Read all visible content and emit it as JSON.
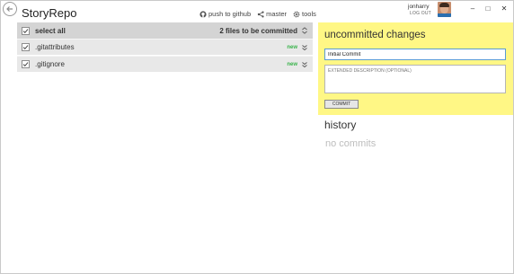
{
  "app": {
    "title": "StoryRepo",
    "back_icon": "back-arrow-icon"
  },
  "toolbar": {
    "push_label": "push to github",
    "branch_label": "master",
    "tools_label": "tools",
    "icons": [
      "github-icon",
      "branch-icon",
      "gear-icon"
    ]
  },
  "user": {
    "name": "jonharry",
    "logout_label": "LOG OUT"
  },
  "window_controls": {
    "minimize": "–",
    "maximize": "□",
    "close": "✕"
  },
  "file_list": {
    "select_all_label": "select all",
    "count_label": "2 files to be committed",
    "files": [
      {
        "name": ".gitattributes",
        "status": "new",
        "checked": true
      },
      {
        "name": ".gitignore",
        "status": "new",
        "checked": true
      }
    ]
  },
  "commit_panel": {
    "title": "uncommitted changes",
    "summary_value": "Initial Commit",
    "description_placeholder": "EXTENDED DESCRIPTION (OPTIONAL)",
    "commit_label": "COMMIT",
    "background_color": "#fff785"
  },
  "history": {
    "title": "history",
    "empty_label": "no commits"
  },
  "colors": {
    "accent_new": "#38b34a",
    "header_row": "#d4d4d4",
    "file_row": "#e8e8e8"
  }
}
